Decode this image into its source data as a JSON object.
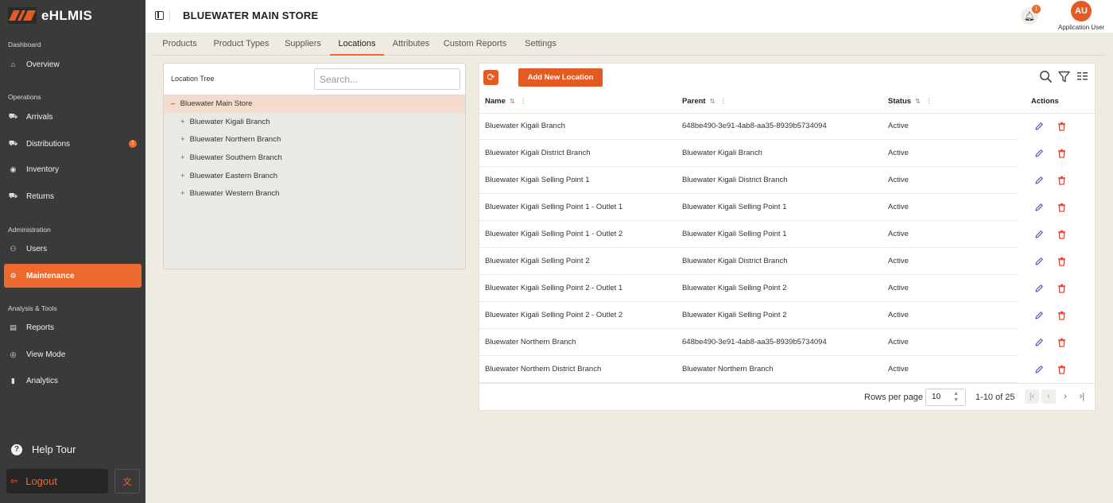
{
  "app": {
    "name": "eHLMIS",
    "store_title": "BLUEWATER MAIN STORE"
  },
  "sidebar": {
    "sections": [
      {
        "label": "Dashboard"
      },
      {
        "label": "Operations"
      },
      {
        "label": "Administration"
      },
      {
        "label": "Analysis & Tools"
      }
    ],
    "items": [
      {
        "label": "Overview",
        "icon": "home-icon"
      },
      {
        "label": "Arrivals",
        "icon": "truck-icon"
      },
      {
        "label": "Distributions",
        "icon": "truck-icon",
        "badge": "1"
      },
      {
        "label": "Inventory",
        "icon": "inventory-icon"
      },
      {
        "label": "Returns",
        "icon": "return-icon"
      },
      {
        "label": "Users",
        "icon": "users-icon"
      },
      {
        "label": "Maintenance",
        "icon": "gear-icon",
        "active": true
      },
      {
        "label": "Reports",
        "icon": "report-icon"
      },
      {
        "label": "View Mode",
        "icon": "eye-icon"
      },
      {
        "label": "Analytics",
        "icon": "chart-icon"
      }
    ],
    "help_tour": "Help Tour",
    "logout": "Logout"
  },
  "header": {
    "notification_count": "1",
    "avatar_initials": "AU",
    "user_name": "Application User"
  },
  "tabs": [
    {
      "label": "Products"
    },
    {
      "label": "Product Types"
    },
    {
      "label": "Suppliers"
    },
    {
      "label": "Locations",
      "active": true
    },
    {
      "label": "Attributes"
    },
    {
      "label": "Custom Reports"
    },
    {
      "label": "Settings"
    }
  ],
  "tree": {
    "title": "Location Tree",
    "search_placeholder": "Search...",
    "root": {
      "symbol": "–",
      "label": "Bluewater Main Store"
    },
    "children": [
      {
        "symbol": "+",
        "label": "Bluewater Kigali Branch"
      },
      {
        "symbol": "+",
        "label": "Bluewater Northern Branch"
      },
      {
        "symbol": "+",
        "label": "Bluewater Southern Branch"
      },
      {
        "symbol": "+",
        "label": "Bluewater Eastern Branch"
      },
      {
        "symbol": "+",
        "label": "Bluewater Western Branch"
      }
    ]
  },
  "table": {
    "add_button": "Add New Location",
    "columns": {
      "name": "Name",
      "parent": "Parent",
      "status": "Status",
      "actions": "Actions"
    },
    "rows": [
      {
        "name": "Bluewater Kigali Branch",
        "parent": "648be490-3e91-4ab8-aa35-8939b5734094",
        "status": "Active"
      },
      {
        "name": "Bluewater Kigali District Branch",
        "parent": "Bluewater Kigali Branch",
        "status": "Active"
      },
      {
        "name": "Bluewater Kigali Selling Point 1",
        "parent": "Bluewater Kigali District Branch",
        "status": "Active"
      },
      {
        "name": "Bluewater Kigali Selling Point 1 - Outlet 1",
        "parent": "Bluewater Kigali Selling Point 1",
        "status": "Active"
      },
      {
        "name": "Bluewater Kigali Selling Point 1 - Outlet 2",
        "parent": "Bluewater Kigali Selling Point 1",
        "status": "Active"
      },
      {
        "name": "Bluewater Kigali Selling Point 2",
        "parent": "Bluewater Kigali District Branch",
        "status": "Active"
      },
      {
        "name": "Bluewater Kigali Selling Point 2 - Outlet 1",
        "parent": "Bluewater Kigali Selling Point 2",
        "status": "Active"
      },
      {
        "name": "Bluewater Kigali Selling Point 2 - Outlet 2",
        "parent": "Bluewater Kigali Selling Point 2",
        "status": "Active"
      },
      {
        "name": "Bluewater Northern Branch",
        "parent": "648be490-3e91-4ab8-aa35-8939b5734094",
        "status": "Active"
      },
      {
        "name": "Bluewater Northern District Branch",
        "parent": "Bluewater Northern Branch",
        "status": "Active"
      }
    ],
    "pagination": {
      "rows_per_page_label": "Rows per page",
      "rows_per_page": "10",
      "range": "1-10 of 25"
    }
  },
  "colors": {
    "accent": "#e35a22",
    "sidebar_bg": "#3a3a3a",
    "edit_icon": "#5b5fc7",
    "delete_icon": "#e0453a"
  }
}
